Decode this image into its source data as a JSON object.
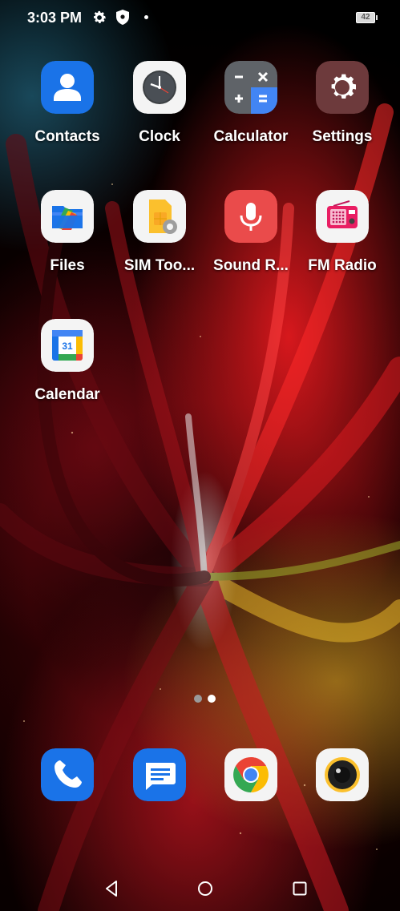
{
  "status_bar": {
    "time": "3:03 PM",
    "battery_level": "42",
    "icons": [
      "gear-icon",
      "shield-icon",
      "notification-dot-icon",
      "battery-icon"
    ]
  },
  "apps": [
    {
      "label": "Contacts",
      "icon": "contacts-icon"
    },
    {
      "label": "Clock",
      "icon": "clock-icon"
    },
    {
      "label": "Calculator",
      "icon": "calculator-icon"
    },
    {
      "label": "Settings",
      "icon": "settings-icon"
    },
    {
      "label": "Files",
      "icon": "files-icon"
    },
    {
      "label": "SIM Too...",
      "icon": "sim-toolkit-icon"
    },
    {
      "label": "Sound R...",
      "icon": "sound-recorder-icon"
    },
    {
      "label": "FM Radio",
      "icon": "fm-radio-icon"
    },
    {
      "label": "Calendar",
      "icon": "calendar-icon",
      "badge_text": "31"
    }
  ],
  "page_indicator": {
    "pages": 2,
    "current": 2,
    "colors": {
      "inactive": "#9a9a9a",
      "active": "#ffffff"
    }
  },
  "dock": [
    {
      "icon": "phone-icon"
    },
    {
      "icon": "messages-icon"
    },
    {
      "icon": "chrome-icon"
    },
    {
      "icon": "camera-icon"
    }
  ],
  "nav_bar": {
    "buttons": [
      "back-icon",
      "home-icon",
      "recents-icon"
    ]
  },
  "colors": {
    "contacts_blue": "#1a73e8",
    "calculator_grey": "#5f6368",
    "settings_bg": "#6d3a3c",
    "recorder_red": "#ea4b4b",
    "phone_blue": "#1a73e8",
    "messages_blue": "#1a73e8"
  }
}
